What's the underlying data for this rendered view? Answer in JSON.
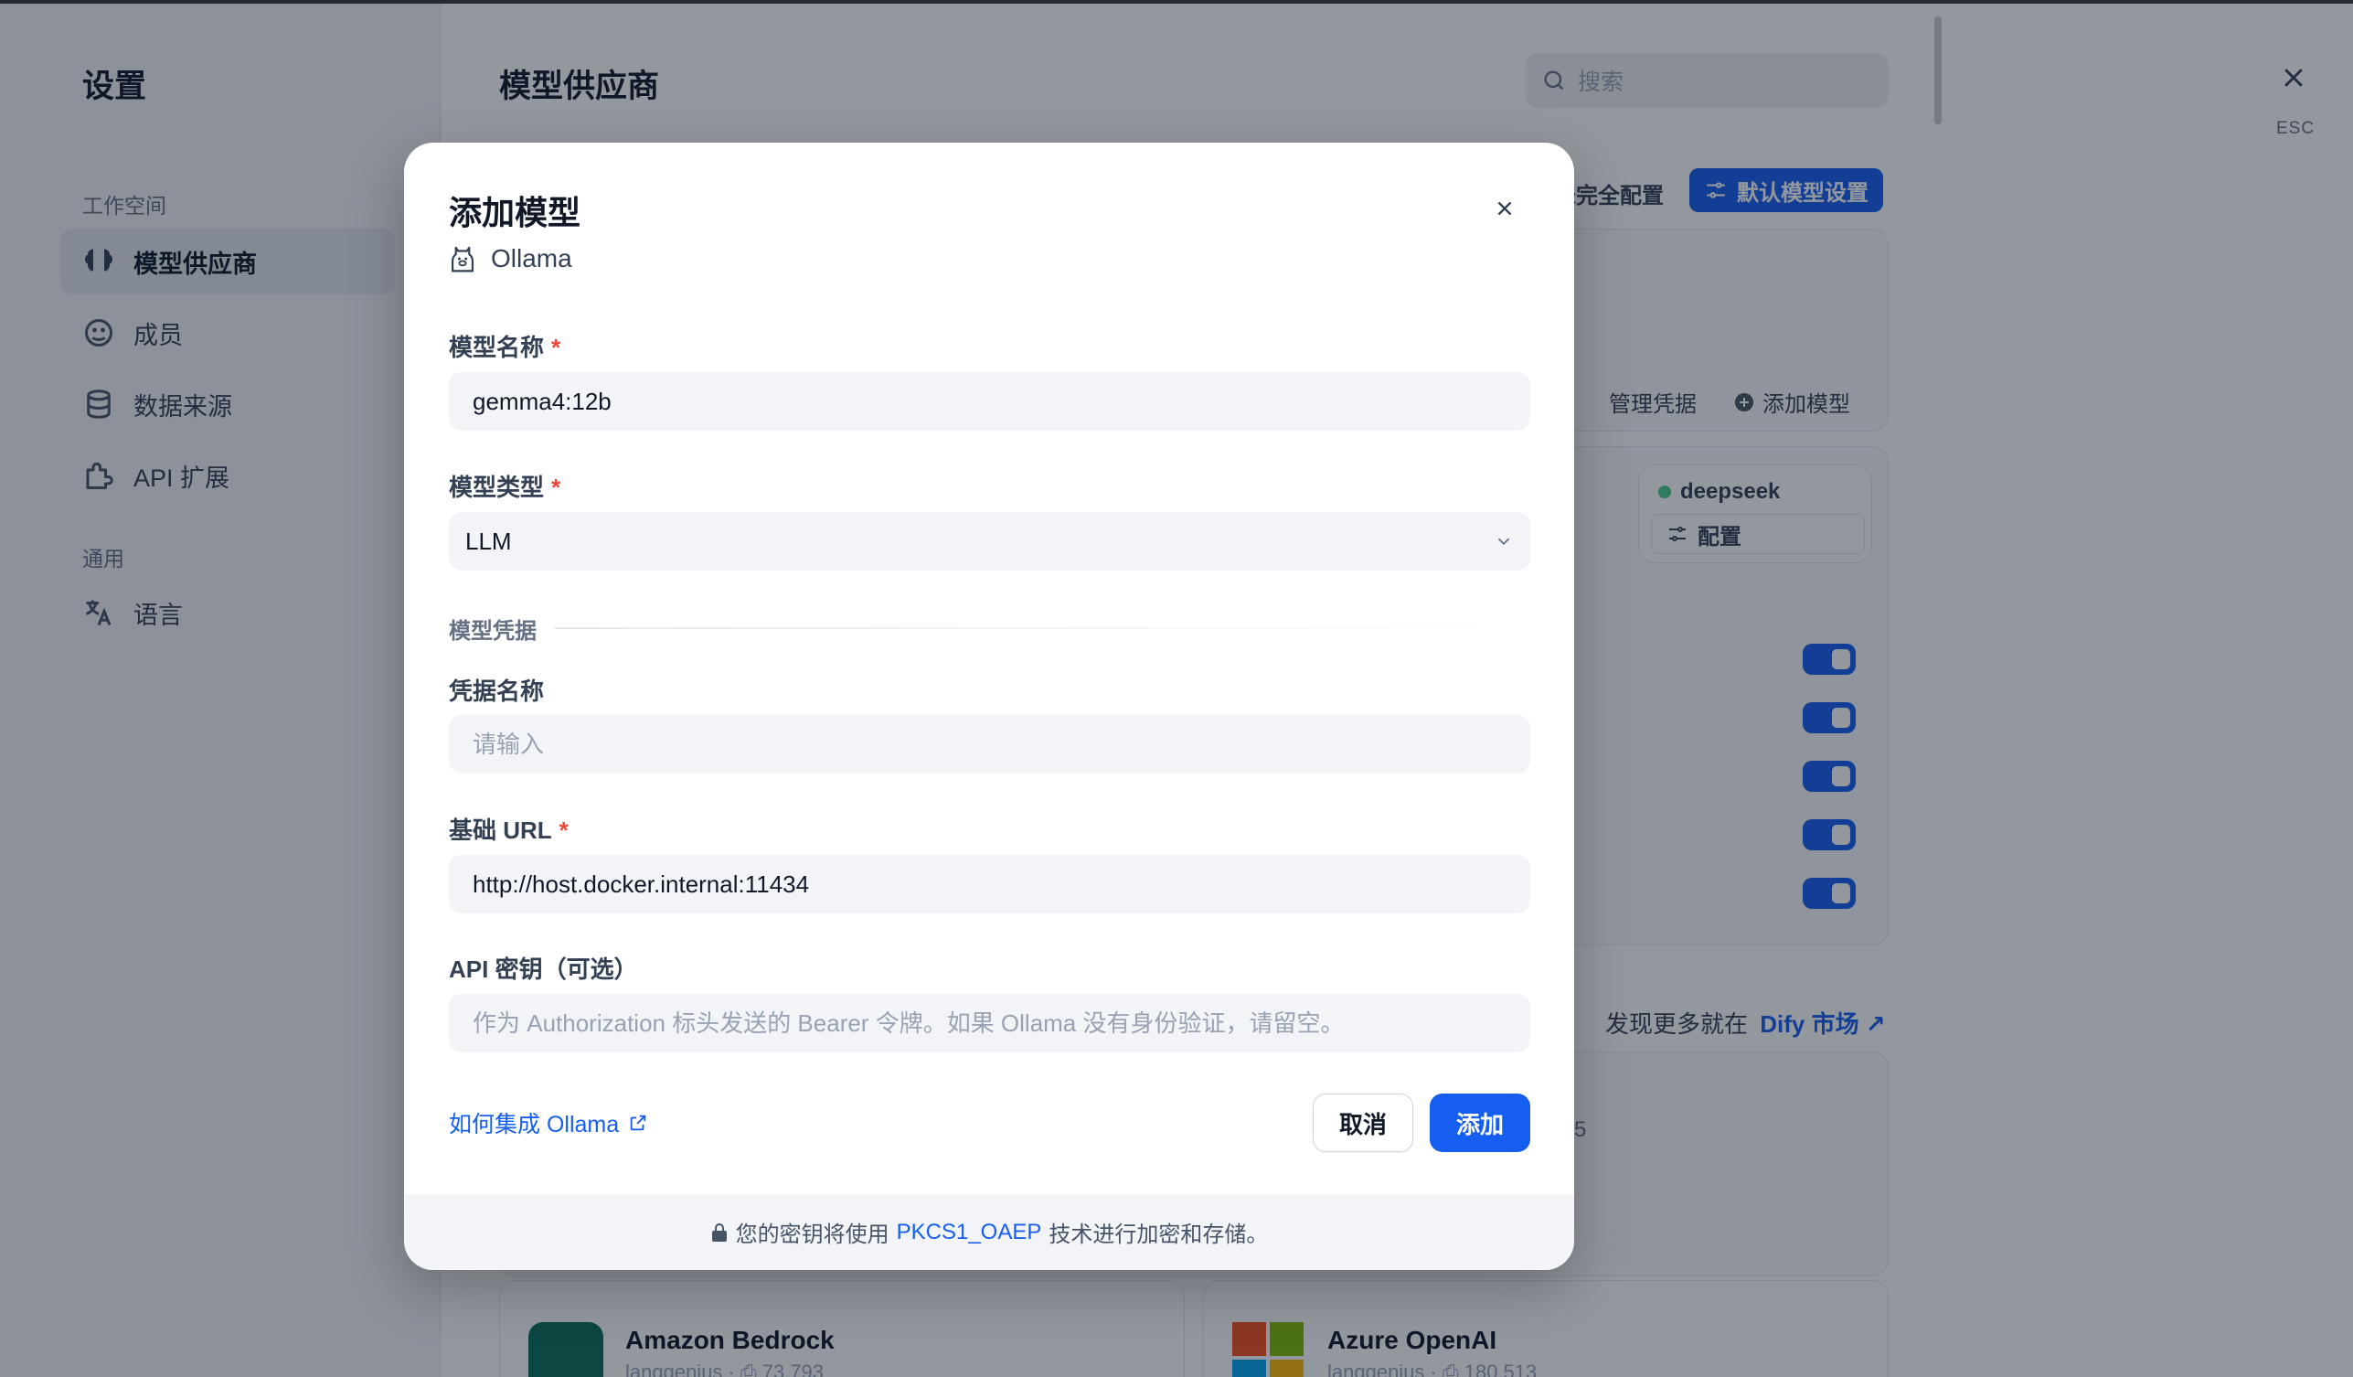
{
  "sidebar": {
    "title": "设置",
    "section_workspace": "工作空间",
    "section_general": "通用",
    "items": [
      {
        "label": "模型供应商"
      },
      {
        "label": "成员"
      },
      {
        "label": "数据来源"
      },
      {
        "label": "API 扩展"
      },
      {
        "label": "语言"
      }
    ]
  },
  "main": {
    "title": "模型供应商",
    "search_placeholder": "搜索",
    "esc_label": "ESC",
    "not_configured_label": "未完全配置",
    "default_model_settings": "默认模型设置",
    "manage_credentials": "管理凭据",
    "add_model": "添加模型",
    "deepseek_label": "deepseek",
    "config_label": "配置",
    "discover_more": "发现更多就在",
    "dify_market": "Dify 市场",
    "partial_number": "5",
    "providers": [
      {
        "name": "Amazon Bedrock",
        "author": "langgenius",
        "installs": "73,793"
      },
      {
        "name": "Azure OpenAI",
        "author": "langgenius",
        "installs": "180,513"
      }
    ]
  },
  "modal": {
    "title": "添加模型",
    "provider": "Ollama",
    "model_name_label": "模型名称",
    "model_name_value": "gemma4:12b",
    "model_type_label": "模型类型",
    "model_type_value": "LLM",
    "credentials_section": "模型凭据",
    "credential_name_label": "凭据名称",
    "credential_name_placeholder": "请输入",
    "base_url_label": "基础 URL",
    "base_url_value": "http://host.docker.internal:11434",
    "api_key_label": "API 密钥（可选）",
    "api_key_placeholder": "作为 Authorization 标头发送的 Bearer 令牌。如果 Ollama 没有身份验证，请留空。",
    "help_link": "如何集成 Ollama",
    "cancel": "取消",
    "add": "添加",
    "footer_prefix": "您的密钥将使用",
    "footer_method": "PKCS1_OAEP",
    "footer_suffix": "技术进行加密和存储。"
  },
  "colors": {
    "primary": "#155eef",
    "required": "#f04438",
    "status_green": "#47cd89"
  }
}
